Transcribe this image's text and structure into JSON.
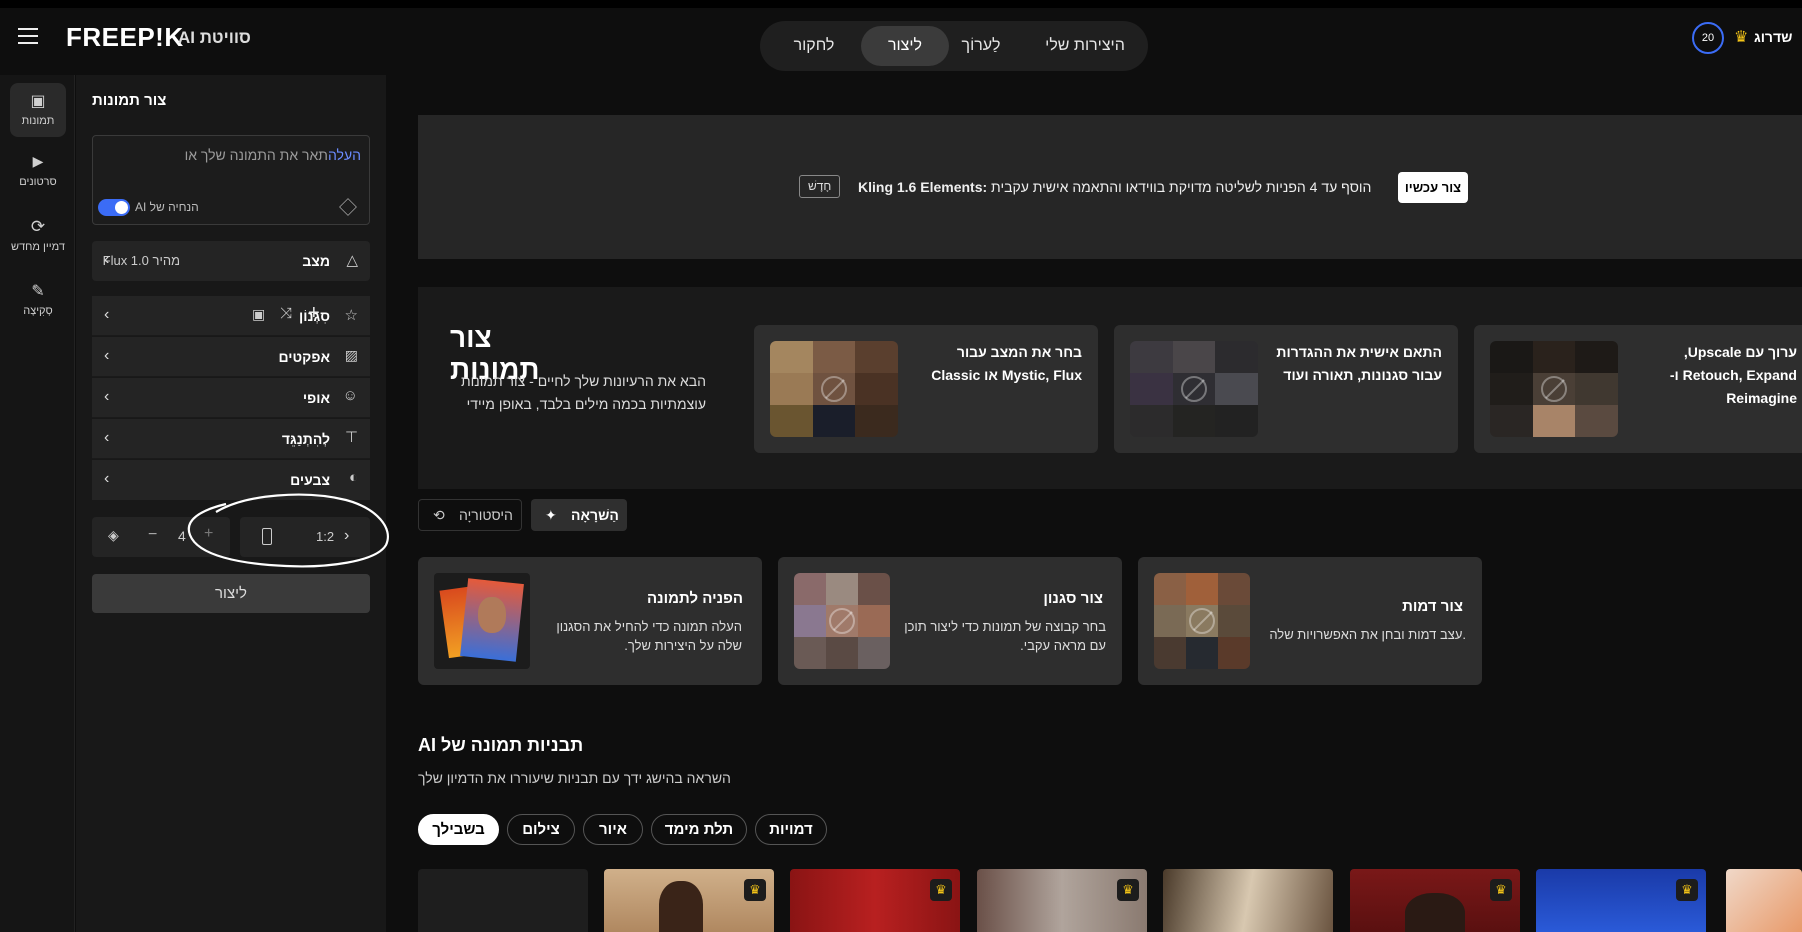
{
  "header": {
    "brand": "FREEP!K",
    "suite": "סוויטת AI",
    "nav": [
      "היצירות שלי",
      "לַערוֹך",
      "ליצור",
      "לחקור"
    ],
    "upgrade": "שדרוג",
    "credits": "20"
  },
  "rail": {
    "items": [
      {
        "label": "תמונות",
        "icon": "image-icon"
      },
      {
        "label": "סרטונים",
        "icon": "video-icon"
      },
      {
        "label": "דמיין מחדש",
        "icon": "refresh-icon"
      },
      {
        "label": "סְקִיצָה",
        "icon": "brush-icon"
      }
    ]
  },
  "panel": {
    "title": "צור תמונות",
    "prompt_link": "העלה",
    "prompt_text": "תאר את התמונה שלך או",
    "ai_guide": "הנחיה של AI",
    "mode_label": "מצב",
    "mode_value": "מהיר Flux 1.0",
    "style_label": "סִגְנוֹן",
    "effects_label": "אפקטים",
    "character_label": "אופי",
    "composition_label": "לְהִתְנַגֵּד",
    "colors_label": "צבעים",
    "count": "4",
    "ratio": "1:2",
    "generate": "ליצור"
  },
  "banner": {
    "new_tag": "חָדָשׁ",
    "title": "Kling 1.6 Elements:",
    "text": "הוסף עד 4 הפניות לשליטה מדויקת בווידאו והתאמה אישית עקבית",
    "cta": "צור עכשיו"
  },
  "hero": {
    "title": "צור תמונות",
    "desc_line1": "הבא את הרעיונות שלך לחיים - צור תמונות",
    "desc_line2": "עוצמתיות בכמה מילים בלבד, באופן מיידי",
    "cards": [
      {
        "line1": "בחר את המצב עבור",
        "line2": "Mystic, Flux או Classic"
      },
      {
        "line1": "התאם אישית את ההגדרות",
        "line2": "עבור סגנונות, תאורה ועוד"
      },
      {
        "line1": "ערוך עם Upscale,",
        "line2": "Retouch, Expand ו-",
        "line3": "Reimagine"
      }
    ]
  },
  "tabs": {
    "inspiration": "הַשׁרָאָה",
    "history": "היסטוריָה"
  },
  "features": [
    {
      "title": "הפניה לתמונה",
      "line1": "העלה תמונה כדי להחיל את הסגנון",
      "line2": "שלה על היצירות שלך."
    },
    {
      "title": "צור סגנון",
      "line1": "בחר קבוצה של תמונות כדי ליצור תוכן",
      "line2": "עם מראה עקבי."
    },
    {
      "title": "צור דמות",
      "line1": ".עצב דמות ובחן את האפשרויות שלה"
    }
  ],
  "templates": {
    "title": "תבניות תמונה של AI",
    "subtitle": "השראה בהישג ידך עם תבניות שיעוררו את הדמיון שלך",
    "tags": [
      "בשבילך",
      "צילום",
      "איור",
      "תלת מימד",
      "דמויות"
    ]
  },
  "colors": {
    "accent": "#3b6cf6",
    "crown": "#f5c518"
  }
}
